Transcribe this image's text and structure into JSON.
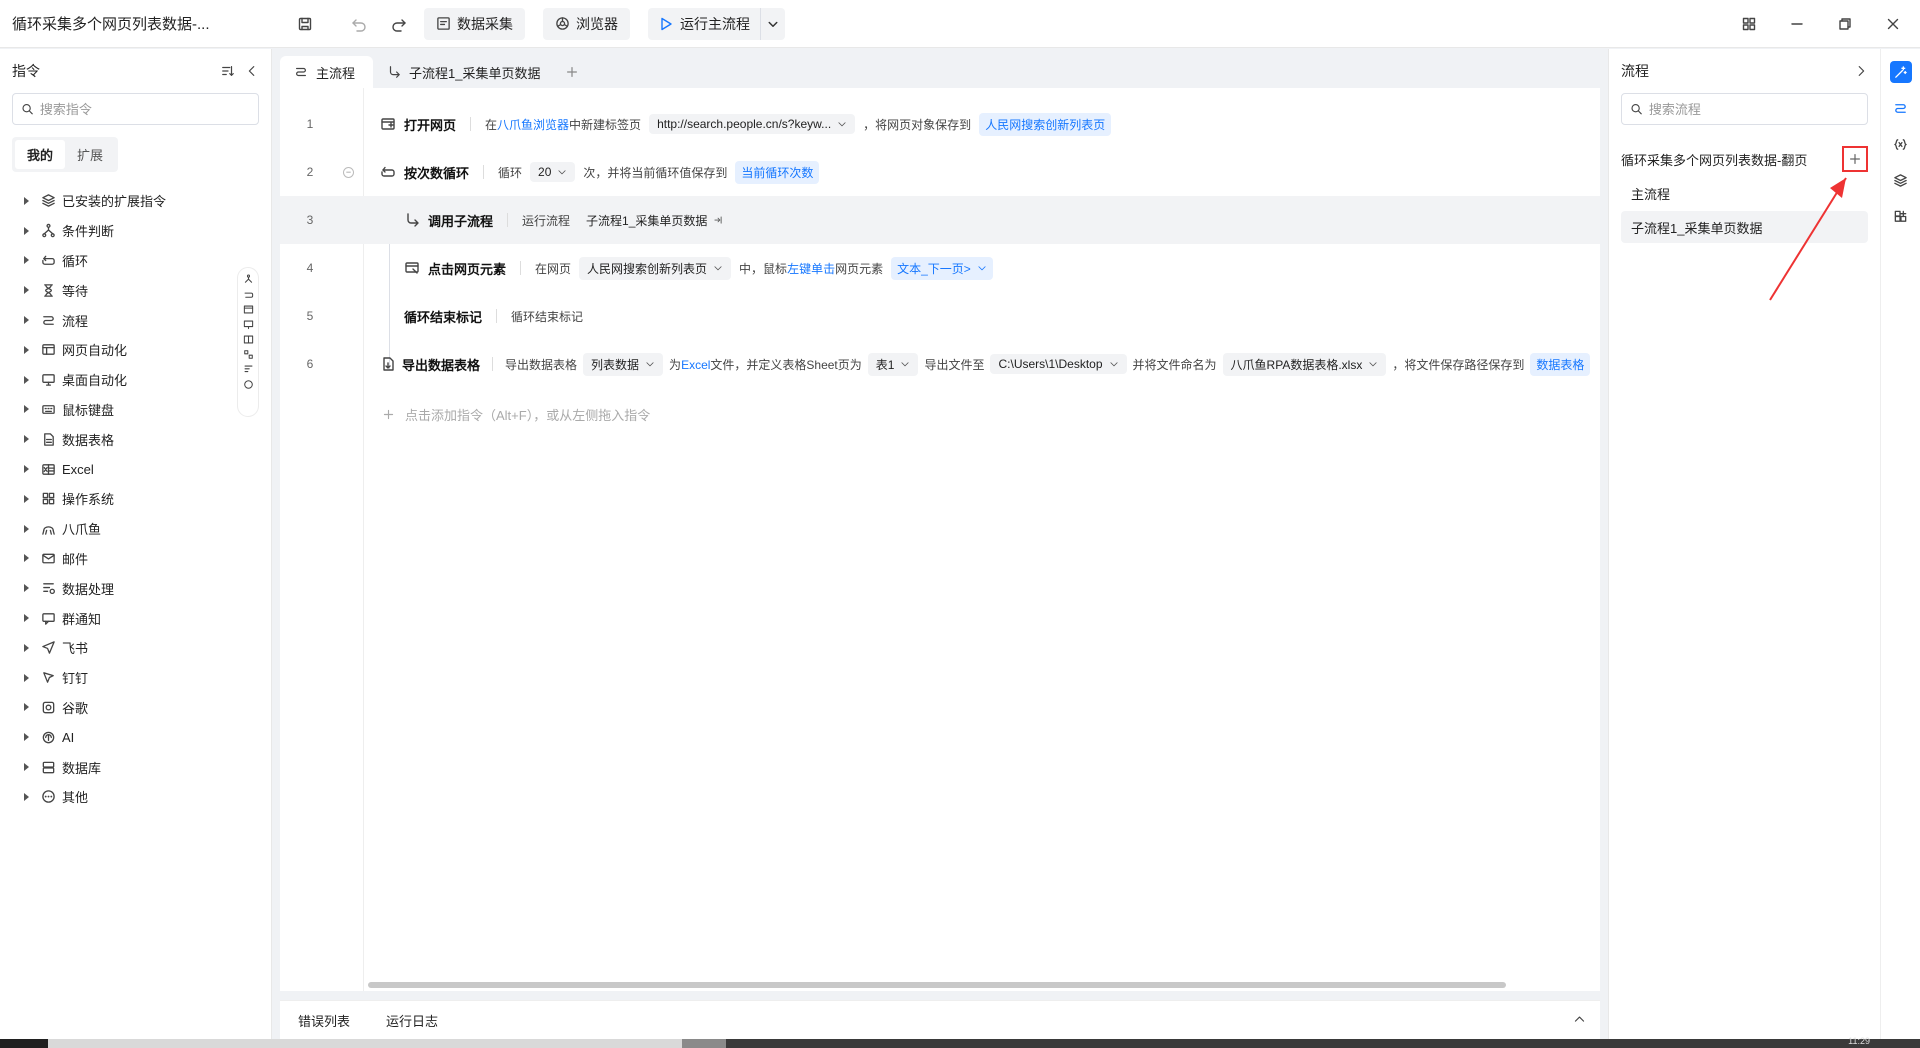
{
  "window": {
    "title": "循环采集多个网页列表数据-...",
    "toolbar": {
      "data_collect_label": "数据采集",
      "browser_label": "浏览器",
      "run_label": "运行主流程"
    }
  },
  "left_panel": {
    "title": "指令",
    "search_placeholder": "搜索指令",
    "segments": [
      "我的",
      "扩展"
    ],
    "categories": [
      {
        "label": "已安装的扩展指令",
        "icon": "layers-icon"
      },
      {
        "label": "条件判断",
        "icon": "branch-icon"
      },
      {
        "label": "循环",
        "icon": "loop-icon"
      },
      {
        "label": "等待",
        "icon": "hourglass-icon"
      },
      {
        "label": "流程",
        "icon": "flow-icon"
      },
      {
        "label": "网页自动化",
        "icon": "browser-window-icon"
      },
      {
        "label": "桌面自动化",
        "icon": "desktop-icon"
      },
      {
        "label": "鼠标键盘",
        "icon": "keyboard-icon"
      },
      {
        "label": "数据表格",
        "icon": "document-icon"
      },
      {
        "label": "Excel",
        "icon": "excel-icon"
      },
      {
        "label": "操作系统",
        "icon": "grid-icon"
      },
      {
        "label": "八爪鱼",
        "icon": "octopus-icon"
      },
      {
        "label": "邮件",
        "icon": "mail-icon"
      },
      {
        "label": "数据处理",
        "icon": "data-process-icon"
      },
      {
        "label": "群通知",
        "icon": "chat-icon"
      },
      {
        "label": "飞书",
        "icon": "send-icon"
      },
      {
        "label": "钉钉",
        "icon": "pin-icon"
      },
      {
        "label": "谷歌",
        "icon": "google-icon"
      },
      {
        "label": "AI",
        "icon": "ai-icon"
      },
      {
        "label": "数据库",
        "icon": "database-icon"
      },
      {
        "label": "其他",
        "icon": "more-icon"
      }
    ]
  },
  "editor": {
    "tabs": [
      "主流程",
      "子流程1_采集单页数据"
    ],
    "rows": [
      {
        "num": "1",
        "command": "打开网页",
        "pre": "在",
        "browser": "八爪鱼浏览器",
        "mid": "中新建标签页",
        "url": "http://search.people.cn/s?keyw...",
        "post": "，将网页对象保存到",
        "var": "人民网搜索创新列表页"
      },
      {
        "num": "2",
        "command": "按次数循环",
        "pre": "循环",
        "count": "20",
        "mid": "次，并将当前循环值保存到",
        "var": "当前循环次数"
      },
      {
        "num": "3",
        "command": "调用子流程",
        "pre": "运行流程",
        "flow": "子流程1_采集单页数据"
      },
      {
        "num": "4",
        "command": "点击网页元素",
        "pre": "在网页",
        "page": "人民网搜索创新列表页",
        "mid": "中，鼠标",
        "click": "左键单击",
        "post": "网页元素",
        "element": "文本_下一页>"
      },
      {
        "num": "5",
        "command": "循环结束标记",
        "desc": "循环结束标记"
      },
      {
        "num": "6",
        "command": "导出数据表格",
        "pre": "导出数据表格",
        "table": "列表数据",
        "as_pre": "为",
        "as_excel": "Excel",
        "as_post": "文件，并定义表格Sheet页为",
        "sheet": "表1",
        "to_label": "导出文件至",
        "path": "C:\\Users\\1\\Desktop",
        "name_label": "并将文件命名为",
        "filename": "八爪鱼RPA数据表格.xlsx",
        "save_label": "，将文件保存路径保存到",
        "save_var": "数据表格"
      }
    ],
    "add_hint": "点击添加指令（Alt+F），或从左侧拖入指令"
  },
  "bottom_tabs": [
    "错误列表",
    "运行日志"
  ],
  "right_panel": {
    "title": "流程",
    "search_placeholder": "搜索流程",
    "project_name": "循环采集多个网页列表数据-翻页",
    "flows": [
      "主流程",
      "子流程1_采集单页数据"
    ],
    "selected_flow": "子流程1_采集单页数据"
  },
  "taskbar": {
    "clock": "11:29"
  },
  "colors": {
    "accent": "#1677ff",
    "highlight_border": "#ee3333",
    "annotation_arrow": "#ee3333"
  }
}
